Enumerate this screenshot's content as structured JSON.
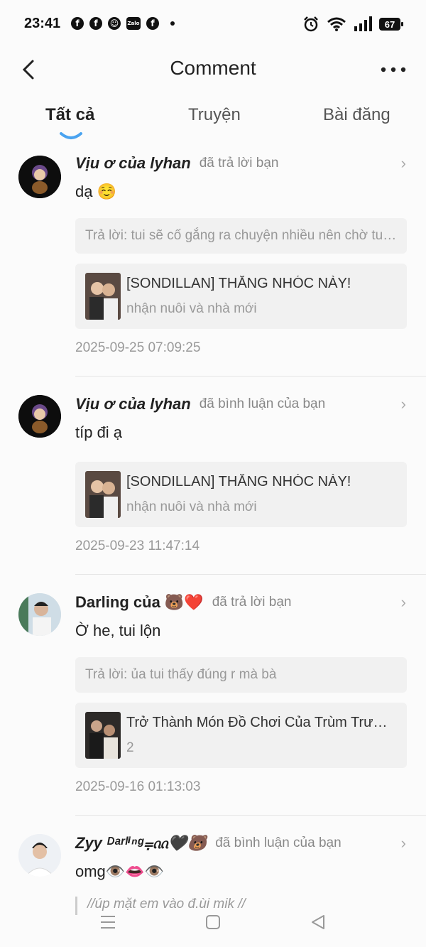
{
  "status": {
    "time": "23:41",
    "app_icons": [
      "facebook-icon",
      "facebook-icon",
      "messenger-icon",
      "zalo-icon",
      "facebook-icon"
    ],
    "app_glyphs": [
      "f",
      "f",
      "☺",
      "Zalo",
      "f"
    ],
    "battery": "67"
  },
  "header": {
    "title": "Comment"
  },
  "tabs": [
    {
      "label": "Tất cả",
      "active": true
    },
    {
      "label": "Truyện",
      "active": false
    },
    {
      "label": "Bài đăng",
      "active": false
    }
  ],
  "notifications": [
    {
      "user": "Vịu ơ của lyhan",
      "action": "đã trả lời bạn",
      "text": "dạ ☺️",
      "reply": "Trả lời: tui sẽ cố gắng ra chuyện nhiều nên chờ tui...",
      "story_title": "[SONDILLAN] THẰNG NHÓC NÀY!",
      "story_sub": "nhận nuôi và nhà mới",
      "time": "2025-09-25 07:09:25"
    },
    {
      "user": "Vịu ơ của lyhan",
      "action": "đã bình luận của bạn",
      "text": "típ đi ạ",
      "story_title": "[SONDILLAN] THẰNG NHÓC NÀY!",
      "story_sub": "nhận nuôi và nhà mới",
      "time": "2025-09-23 11:47:14"
    },
    {
      "user": "Darling của 🐻❤️",
      "action": "đã trả lời bạn",
      "text": "Ờ he, tui lộn",
      "reply": "Trả lời: ủa tui thấy đúng r mà bà",
      "story_title": "Trở Thành Món Đồ Chơi Của Trùm Trường...",
      "story_sub": "2",
      "time": "2025-09-16 01:13:03"
    },
    {
      "user": "Zyy ᴰᵃʳˡⁱⁿᵍ⩦ᦶ🖤🐻",
      "action": "đã bình luận của bạn",
      "text": "omg👁️👄👁️",
      "quote": "//úp mặt em vào đ.ùi mik //"
    }
  ],
  "colors": {
    "accent": "#4aa3f0",
    "background": "#fbfbfb",
    "card": "#f1f1f1"
  }
}
